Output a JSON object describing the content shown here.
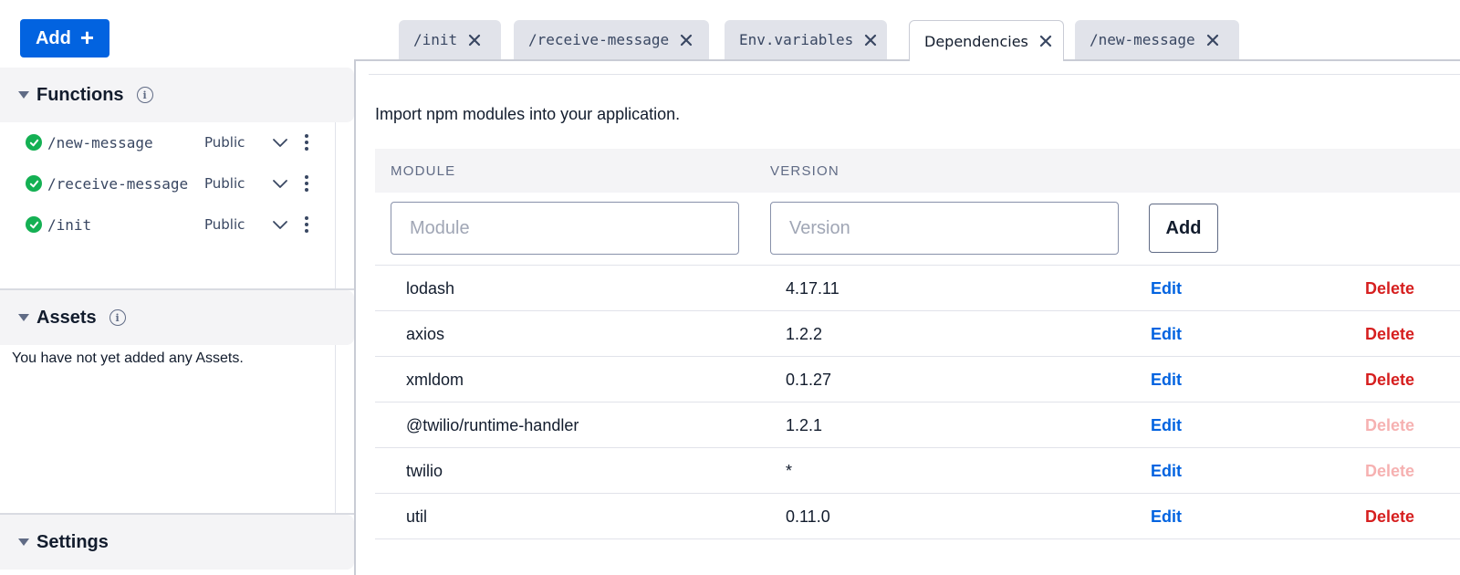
{
  "sidebar": {
    "add_label": "Add",
    "functions": {
      "title": "Functions",
      "items": [
        {
          "name": "/new-message",
          "visibility": "Public"
        },
        {
          "name": "/receive-message",
          "visibility": "Public"
        },
        {
          "name": "/init",
          "visibility": "Public"
        }
      ]
    },
    "assets": {
      "title": "Assets",
      "empty_text": "You have not yet added any Assets."
    },
    "settings": {
      "title": "Settings"
    }
  },
  "tabs": [
    {
      "label": "/init",
      "active": false
    },
    {
      "label": "/receive-message",
      "active": false
    },
    {
      "label": "Env.variables",
      "active": false
    },
    {
      "label": "Dependencies",
      "active": true
    },
    {
      "label": "/new-message",
      "active": false
    }
  ],
  "dependencies": {
    "intro": "Import npm modules into your application.",
    "columns": {
      "module": "MODULE",
      "version": "VERSION"
    },
    "module_placeholder": "Module",
    "version_placeholder": "Version",
    "add_label": "Add",
    "edit_label": "Edit",
    "delete_label": "Delete",
    "rows": [
      {
        "module": "lodash",
        "version": "4.17.11",
        "delete_enabled": true
      },
      {
        "module": "axios",
        "version": "1.2.2",
        "delete_enabled": true
      },
      {
        "module": "xmldom",
        "version": "0.1.27",
        "delete_enabled": true
      },
      {
        "module": "@twilio/runtime-handler",
        "version": "1.2.1",
        "delete_enabled": false
      },
      {
        "module": "twilio",
        "version": "*",
        "delete_enabled": false
      },
      {
        "module": "util",
        "version": "0.11.0",
        "delete_enabled": true
      }
    ]
  },
  "colors": {
    "primary": "#0263e0",
    "success": "#14b053",
    "danger": "#d61f1f",
    "danger_disabled": "#f6b1b1"
  },
  "icons": {
    "add": "plus-icon",
    "info": "info-icon",
    "status": "check-circle-icon",
    "expand": "chevron-down-icon",
    "more": "more-vertical-icon",
    "close_tab": "close-icon",
    "collapse": "caret-down-icon"
  }
}
